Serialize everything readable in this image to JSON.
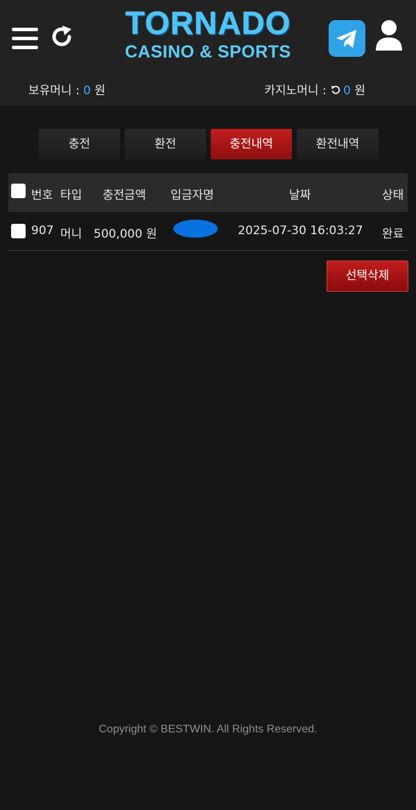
{
  "header": {
    "logo_top": "TORNADO",
    "logo_bottom": "CASINO & SPORTS",
    "menu_icon": "hamburger-icon",
    "refresh_icon": "refresh-icon",
    "telegram_icon": "telegram-icon",
    "user_icon": "user-icon"
  },
  "balance": {
    "held_label": "보유머니 :",
    "held_value": "0",
    "held_unit": "원",
    "casino_label": "카지노머니 :",
    "casino_value": "0",
    "casino_unit": "원"
  },
  "tabs": [
    {
      "label": "충전",
      "active": false
    },
    {
      "label": "환전",
      "active": false
    },
    {
      "label": "충전내역",
      "active": true
    },
    {
      "label": "환전내역",
      "active": false
    }
  ],
  "table": {
    "columns": [
      "번호",
      "타입",
      "충전금액",
      "입금자명",
      "날짜",
      "상태"
    ],
    "rows": [
      {
        "no": "907",
        "type": "머니",
        "amount": "500,000 원",
        "depositor": "",
        "date": "2025-07-30 16:03:27",
        "status": "완료"
      }
    ]
  },
  "actions": {
    "delete_selected": "선택삭제"
  },
  "footer": {
    "copyright": "Copyright © BESTWIN. All Rights Reserved."
  },
  "colors": {
    "accent_red": "#b71818",
    "accent_blue": "#3ea8ff",
    "logo_blue": "#4dc4f7",
    "background": "#161616"
  }
}
